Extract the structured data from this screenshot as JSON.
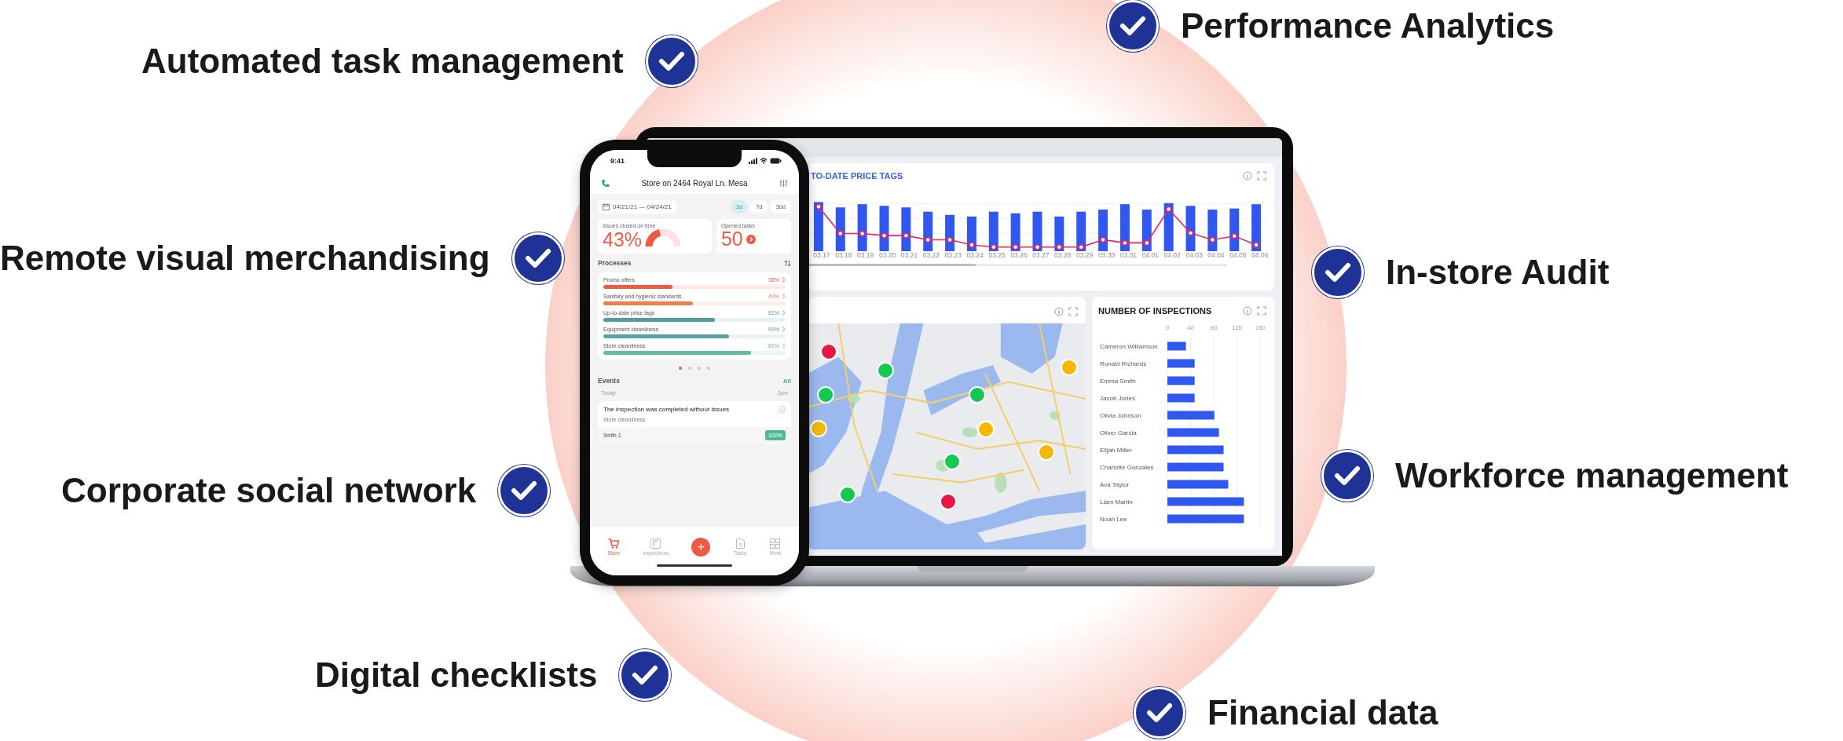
{
  "features": [
    {
      "label": "Performance Analytics"
    },
    {
      "label": "Automated task management"
    },
    {
      "label": "Remote visual merchandising"
    },
    {
      "label": "In-store Audit"
    },
    {
      "label": "Workforce management"
    },
    {
      "label": "Corporate social network"
    },
    {
      "label": "Digital checklists"
    },
    {
      "label": "Financial data"
    }
  ],
  "phone": {
    "time": "9:41",
    "store": "Store on 2464 Royal Ln. Mesa",
    "date_range": "04/21/21 — 04/24/21",
    "periods": [
      {
        "label": "3d",
        "selected": true
      },
      {
        "label": "7d",
        "selected": false
      },
      {
        "label": "30d",
        "selected": false
      }
    ],
    "issues": {
      "label": "Issues closed on time",
      "value": "43%",
      "level": 0.43
    },
    "opened": {
      "label": "Opened tasks",
      "value": "50"
    },
    "processes_title": "Processes",
    "processes": [
      {
        "name": "Promo offers",
        "percent": "38%",
        "level": 0.38,
        "color": "#ef5a45"
      },
      {
        "name": "Sanitary and hygienic standards",
        "percent": "49%",
        "level": 0.49,
        "color": "#e8804f"
      },
      {
        "name": "Up-to-date price tags",
        "percent": "61%",
        "level": 0.61,
        "color": "#4f9f9c"
      },
      {
        "name": "Equipment cleanliness",
        "percent": "69%",
        "level": 0.69,
        "color": "#56a3a1"
      },
      {
        "name": "Store cleanliness",
        "percent": "81%",
        "level": 0.81,
        "color": "#66bb9b"
      }
    ],
    "pager": [
      {
        "selected": true
      },
      {
        "selected": false
      },
      {
        "selected": false
      },
      {
        "selected": false
      }
    ],
    "events_title": "Events",
    "events_link": "All",
    "day": "Today",
    "time_label": "2pm",
    "event": {
      "title": "The inspection was completed without issues",
      "subtitle": "Store cleanliness",
      "author": "Smith J.",
      "badge": "100%"
    },
    "tabs": [
      {
        "kind": "tab",
        "label": "Store",
        "selected": true
      },
      {
        "kind": "tab",
        "label": "Inspections",
        "selected": false
      },
      {
        "kind": "add",
        "label": "+"
      },
      {
        "kind": "tab",
        "label": "Tasks",
        "selected": false
      },
      {
        "kind": "tab",
        "label": "More",
        "selected": false
      }
    ]
  },
  "dashboard": {
    "price_chart": {
      "title": "TO-DATE PRICE TAGS",
      "x_labels": [
        "03.17",
        "03.18",
        "03.19",
        "03.20",
        "03.21",
        "03.22",
        "03.23",
        "03.24",
        "03.25",
        "03.26",
        "03.27",
        "03.28",
        "03.29",
        "03.30",
        "03.31",
        "04.01",
        "04.02",
        "04.03",
        "04.04",
        "04.05",
        "04.06"
      ]
    },
    "map": {
      "markers": [
        {
          "color": "#ea1543"
        },
        {
          "color": "#14c850"
        },
        {
          "color": "#14c850"
        },
        {
          "color": "#f5b800"
        },
        {
          "color": "#14c850"
        },
        {
          "color": "#f5b800"
        },
        {
          "color": "#f5b800"
        },
        {
          "color": "#f5b800"
        },
        {
          "color": "#14c850"
        },
        {
          "color": "#14c850"
        },
        {
          "color": "#ea1543"
        }
      ]
    },
    "inspections": {
      "title": "NUMBER OF INSPECTIONS",
      "chart_data": {
        "type": "bar",
        "orientation": "horizontal",
        "categories": [
          "Cameron Williamson",
          "Ronald Richards",
          "Emma Smith",
          "Jacob Jones",
          "Olivia Johnson",
          "Oliver Garcia",
          "Elijah Miller",
          "Charlotte Gonzales",
          "Ava Taylor",
          "Liam Martin",
          "Noah Lee"
        ],
        "values": [
          32,
          47,
          47,
          47,
          81,
          89,
          97,
          97,
          105,
          132,
          132
        ],
        "xlim": [
          0,
          160
        ],
        "xticks": [
          0,
          40,
          80,
          120,
          160
        ],
        "grid": true
      }
    }
  }
}
